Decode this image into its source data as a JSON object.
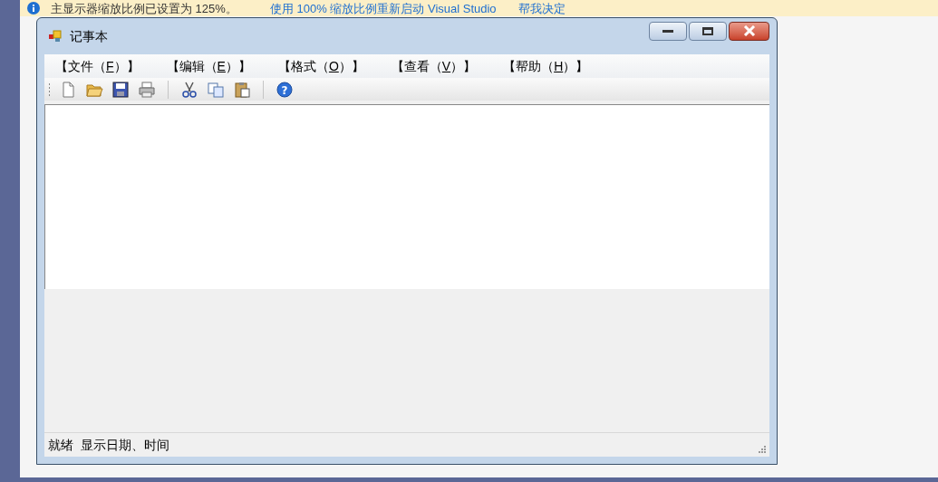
{
  "banner": {
    "message": "主显示器缩放比例已设置为 125%。",
    "links": [
      "使用 100% 缩放比例重新启动 Visual Studio",
      "帮我决定"
    ]
  },
  "window": {
    "title": "记事本"
  },
  "menu": [
    {
      "label": "【文件（",
      "key": "F",
      "end": "）】"
    },
    {
      "label": "【编辑（",
      "key": "E",
      "end": "）】"
    },
    {
      "label": "【格式（",
      "key": "O",
      "end": "）】"
    },
    {
      "label": "【查看（",
      "key": "V",
      "end": "）】"
    },
    {
      "label": "【帮助（",
      "key": "H",
      "end": "）】"
    }
  ],
  "toolbar": [
    {
      "kind": "new"
    },
    {
      "kind": "open"
    },
    {
      "kind": "save"
    },
    {
      "kind": "print"
    },
    {
      "kind": "separator"
    },
    {
      "kind": "cut"
    },
    {
      "kind": "copy"
    },
    {
      "kind": "paste"
    },
    {
      "kind": "separator"
    },
    {
      "kind": "help",
      "glyph": "?"
    }
  ],
  "status_bar": [
    "就绪",
    "显示日期、时间"
  ]
}
